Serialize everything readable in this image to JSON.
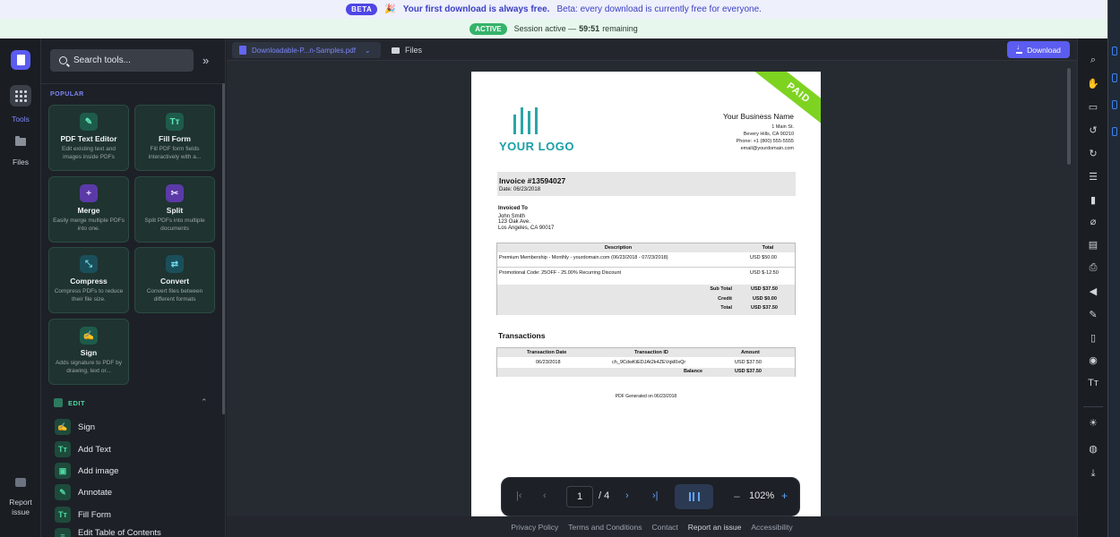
{
  "banners": {
    "beta_badge": "BETA",
    "beta_emoji": "🎉",
    "beta_bold": "Your first download is always free.",
    "beta_rest": "Beta: every download is currently free for everyone.",
    "active_badge": "ACTIVE",
    "session_text": "Session active —",
    "session_time": "59:51",
    "session_suffix": "remaining"
  },
  "rail": {
    "tools_label": "Tools",
    "files_label": "Files",
    "report_label": "Report issue"
  },
  "panel": {
    "search_placeholder": "Search tools...",
    "popular_heading": "POPULAR",
    "cards": [
      {
        "title": "PDF Text Editor",
        "desc": "Edit existing text and images inside PDFs",
        "icon": "edit-icon"
      },
      {
        "title": "Fill Form",
        "desc": "Fill PDF form fields interactively with a...",
        "icon": "text-tool-icon"
      },
      {
        "title": "Merge",
        "desc": "Easily merge multiple PDFs into one.",
        "icon": "merge-icon"
      },
      {
        "title": "Split",
        "desc": "Split PDFs into multiple documents",
        "icon": "scissors-icon"
      },
      {
        "title": "Compress",
        "desc": "Compress PDFs to reduce their file size.",
        "icon": "compress-icon"
      },
      {
        "title": "Convert",
        "desc": "Convert files between different formats",
        "icon": "convert-icon"
      },
      {
        "title": "Sign",
        "desc": "Adds signature to PDF by drawing, text or...",
        "icon": "signature-icon"
      }
    ],
    "edit_heading": "EDIT",
    "edit_items": [
      "Sign",
      "Add Text",
      "Add image",
      "Annotate",
      "Fill Form",
      "Edit Table of Contents"
    ]
  },
  "viewer": {
    "file_tab": "Downloadable-P...n-Samples.pdf",
    "files_tab": "Files",
    "download_label": "Download"
  },
  "invoice": {
    "stamp": "PAID",
    "logo_text": "YOUR LOGO",
    "business_name": "Your Business Name",
    "business_lines": [
      "1 Main St.",
      "Bevery Hills, CA 90210",
      "Phone: +1 (800) 555-5555",
      "email@yourdomain.com"
    ],
    "invoice_number": "Invoice #13594027",
    "invoice_date": "Date: 06/23/2018",
    "invoiced_to_label": "Invoiced To",
    "invoiced_to_lines": [
      "John Smith",
      "123 Oak Ave.",
      "Los Angeles, CA 90017"
    ],
    "items_header": {
      "description": "Description",
      "total": "Total"
    },
    "items": [
      {
        "description": "Premium Membership - Monthly - yourdomain.com (06/23/2018 - 07/23/2018)",
        "total": "USD $50.00"
      },
      {
        "description": "Promotional Code: 25OFF - 25.00% Recurring Discount",
        "total": "USD $-12.50"
      }
    ],
    "totals": [
      {
        "label": "Sub Total",
        "value": "USD $37.50"
      },
      {
        "label": "Credit",
        "value": "USD $0.00"
      },
      {
        "label": "Total",
        "value": "USD $37.50"
      }
    ],
    "transactions_title": "Transactions",
    "tx_header": {
      "date": "Transaction Date",
      "id": "Transaction ID",
      "amount": "Amount"
    },
    "tx_row": {
      "date": "06/23/2018",
      "id": "ch_9CdwKtEDJAt2k4ZEVqkl0xQr",
      "amount": "USD $37.50"
    },
    "balance_label": "Balance",
    "balance_value": "USD $37.50",
    "generated": "PDF Generated on 06/23/2018"
  },
  "pager": {
    "current_page": "1",
    "total_pages": "/ 4",
    "zoom": "102%"
  },
  "footer": {
    "links": [
      "Privacy Policy",
      "Terms and Conditions",
      "Contact",
      "Report an issue",
      "Accessibility"
    ]
  },
  "colors": {
    "accent": "#5b5cf0",
    "paid_stamp": "#7ed321",
    "logo_teal": "#1a9fa5"
  }
}
